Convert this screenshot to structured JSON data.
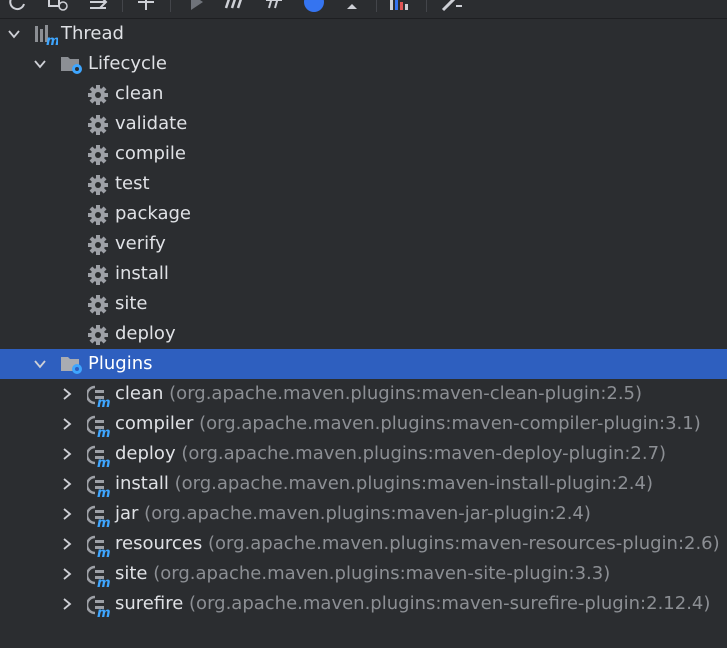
{
  "toolbar": {
    "icons": [
      "refresh-icon",
      "reimport-icon",
      "download-icon",
      "add-icon",
      "run-icon",
      "maven-goal-icon",
      "toggle-offline-icon",
      "help-icon",
      "collapse-icon",
      "show-diagram-icon",
      "settings-icon"
    ]
  },
  "tree": {
    "root": {
      "label": "Thread",
      "icon": "maven-project-icon"
    },
    "lifecycle": {
      "label": "Lifecycle",
      "goals": [
        "clean",
        "validate",
        "compile",
        "test",
        "package",
        "verify",
        "install",
        "site",
        "deploy"
      ]
    },
    "plugins": {
      "label": "Plugins",
      "selected": true,
      "items": [
        {
          "name": "clean",
          "coord": "(org.apache.maven.plugins:maven-clean-plugin:2.5)"
        },
        {
          "name": "compiler",
          "coord": "(org.apache.maven.plugins:maven-compiler-plugin:3.1)"
        },
        {
          "name": "deploy",
          "coord": "(org.apache.maven.plugins:maven-deploy-plugin:2.7)"
        },
        {
          "name": "install",
          "coord": "(org.apache.maven.plugins:maven-install-plugin:2.4)"
        },
        {
          "name": "jar",
          "coord": "(org.apache.maven.plugins:maven-jar-plugin:2.4)"
        },
        {
          "name": "resources",
          "coord": "(org.apache.maven.plugins:maven-resources-plugin:2.6)"
        },
        {
          "name": "site",
          "coord": "(org.apache.maven.plugins:maven-site-plugin:3.3)"
        },
        {
          "name": "surefire",
          "coord": "(org.apache.maven.plugins:maven-surefire-plugin:2.12.4)"
        }
      ]
    }
  },
  "colors": {
    "background": "#2b2d30",
    "selection": "#2e5fbf",
    "text": "#dfe1e5",
    "secondary_text": "#8c8f94",
    "maven_blue": "#3ea6ff"
  }
}
